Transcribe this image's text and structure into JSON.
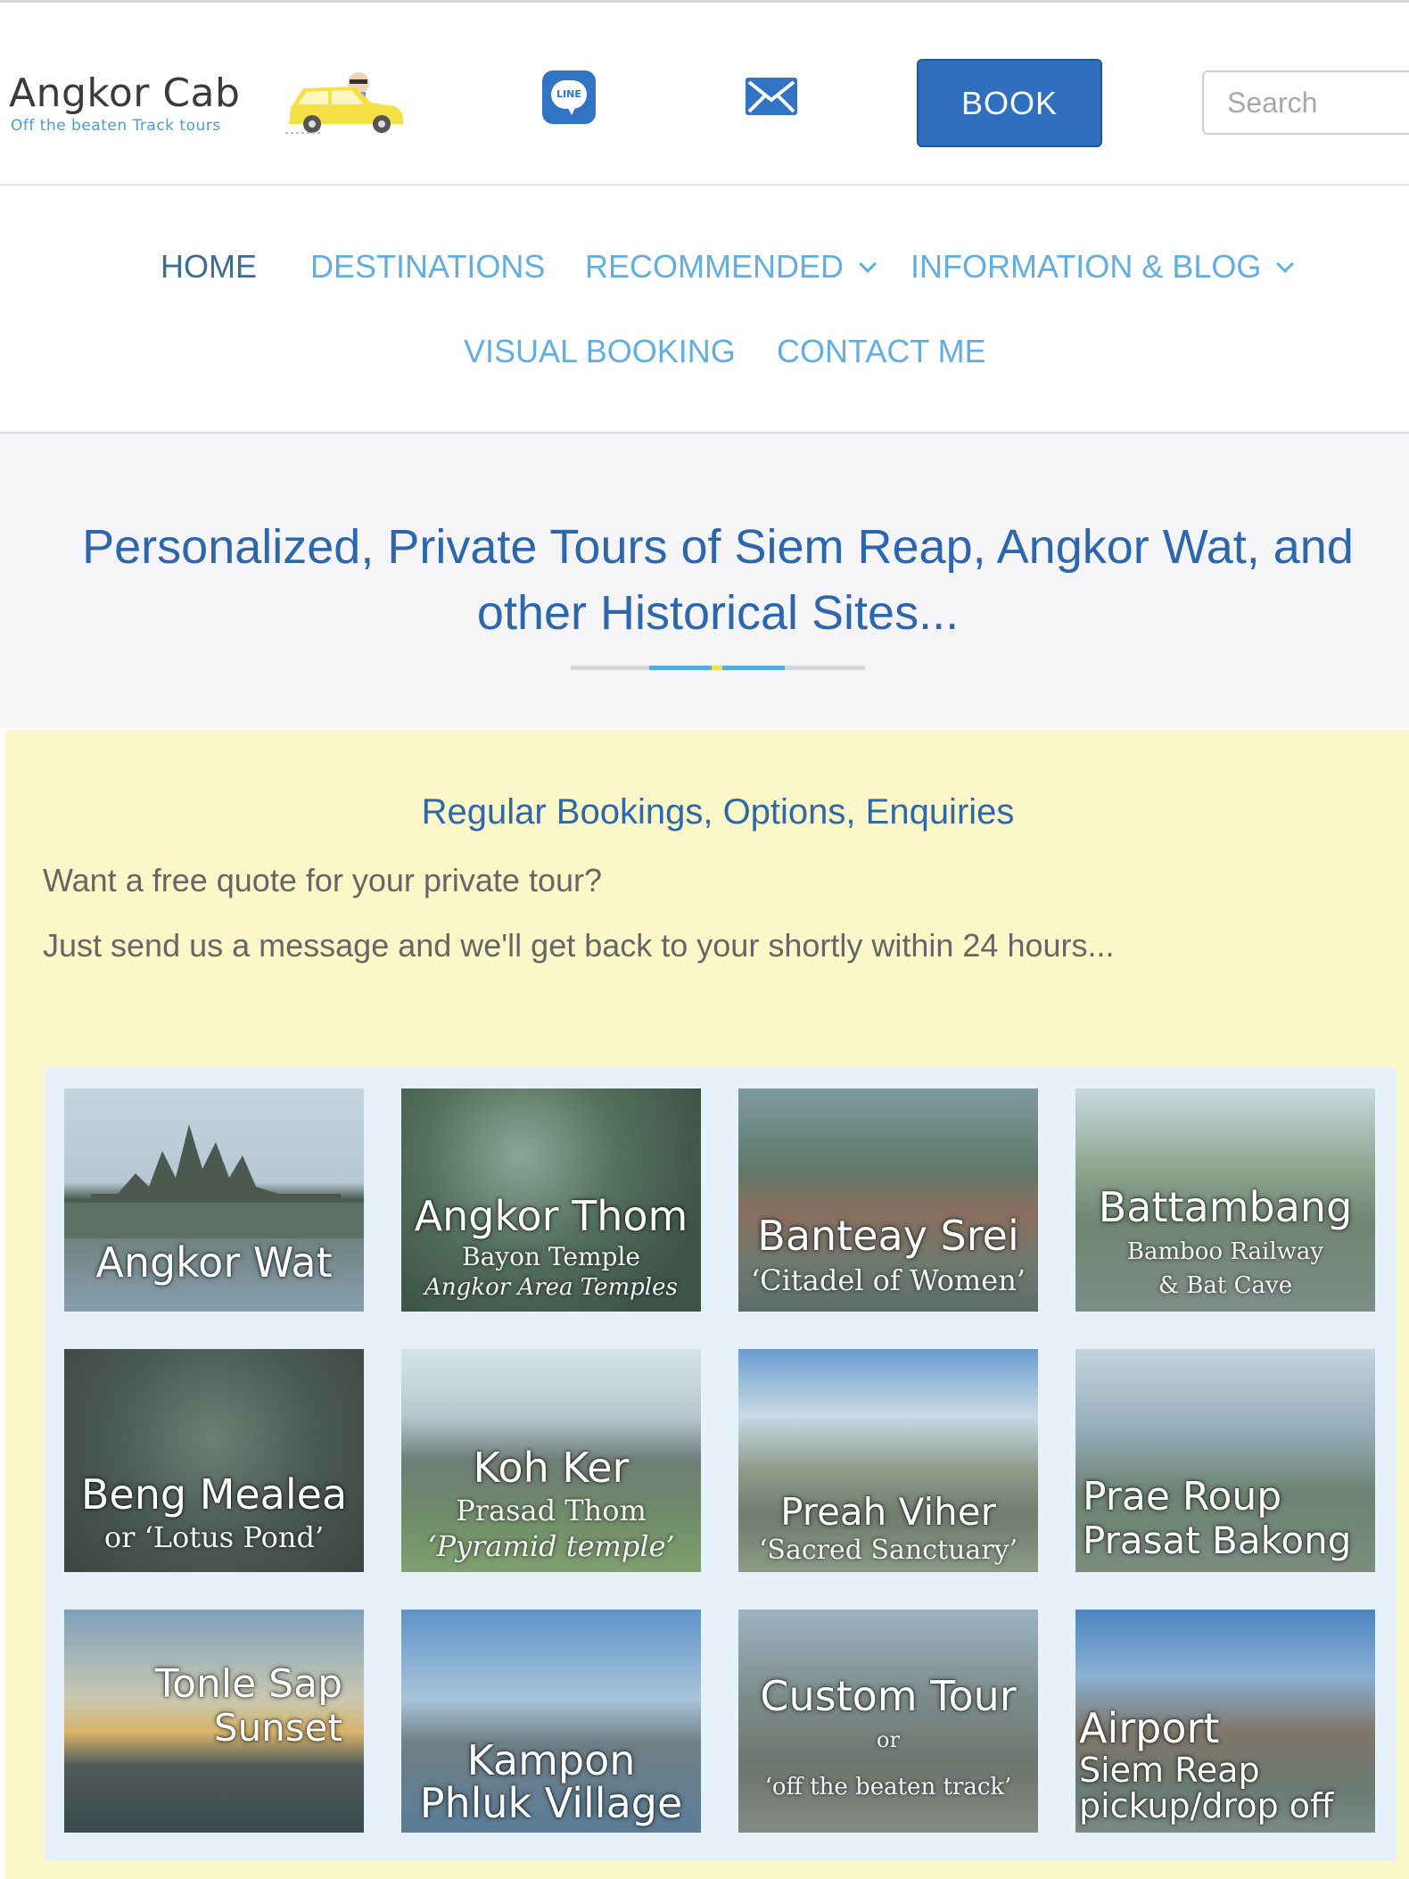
{
  "header": {
    "logo_title": "Angkor Cab",
    "logo_tagline": "Off the beaten Track tours",
    "line_label": "LINE",
    "book_label": "BOOK",
    "search_placeholder": "Search"
  },
  "nav": {
    "items": [
      {
        "label": "HOME",
        "active": true
      },
      {
        "label": "DESTINATIONS"
      },
      {
        "label": "RECOMMENDED",
        "dropdown": true
      },
      {
        "label": "INFORMATION & BLOG",
        "dropdown": true
      },
      {
        "label": "VISUAL BOOKING"
      },
      {
        "label": "CONTACT ME"
      }
    ]
  },
  "hero": {
    "title_line1": "Personalized, Private Tours of Siem Reap, Angkor Wat, and",
    "title_line2": "other Historical Sites..."
  },
  "booking": {
    "title": "Regular Bookings, Options, Enquiries",
    "line1": "Want a free quote for your private tour?",
    "line2": "Just send us a message and we'll get back to your shortly within 24 hours..."
  },
  "tiles": [
    {
      "title": "Angkor Wat",
      "sub1": "",
      "sub2": ""
    },
    {
      "title": "Angkor Thom",
      "sub1": "Bayon Temple",
      "sub2": "Angkor Area Temples"
    },
    {
      "title": "Banteay Srei",
      "sub1": "‘Citadel of Women’",
      "sub2": ""
    },
    {
      "title": "Battambang",
      "sub1": "Bamboo Railway",
      "sub2": "& Bat Cave"
    },
    {
      "title": "Beng Mealea",
      "sub1": "or ‘Lotus Pond’",
      "sub2": ""
    },
    {
      "title": "Koh Ker",
      "sub1": "Prasad Thom",
      "sub2": "‘Pyramid temple’"
    },
    {
      "title": "Preah Viher",
      "sub1": "‘Sacred Sanctuary’",
      "sub2": ""
    },
    {
      "title": "Prae Roup",
      "sub1": "Prasat Bakong",
      "sub2": ""
    },
    {
      "title": "Tonle Sap",
      "sub1": "Sunset",
      "sub2": ""
    },
    {
      "title": "Kampon",
      "sub1": "Phluk Village",
      "sub2": ""
    },
    {
      "title": "Custom Tour",
      "sub1": "or",
      "sub2": "‘off the beaten track’"
    },
    {
      "title": "Airport",
      "sub1": "Siem Reap",
      "sub2": "pickup/drop off"
    }
  ],
  "colors": {
    "brand_blue": "#2f6fbd",
    "nav_link": "#62aee0",
    "booking_bg": "#fbf7c8",
    "heading_blue": "#2c67ad"
  }
}
